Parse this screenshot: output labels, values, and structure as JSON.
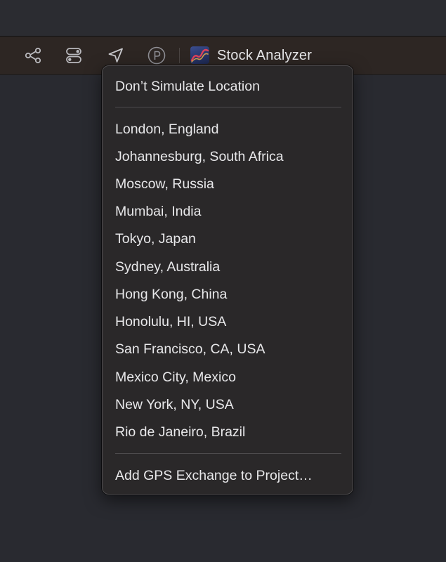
{
  "toolbar": {
    "icons": [
      "source-control-icon",
      "toggle-icon",
      "location-arrow-icon",
      "package-icon"
    ],
    "app_title": "Stock Analyzer"
  },
  "menu": {
    "top_item": "Don’t Simulate Location",
    "locations": [
      "London, England",
      "Johannesburg, South Africa",
      "Moscow, Russia",
      "Mumbai, India",
      "Tokyo, Japan",
      "Sydney, Australia",
      "Hong Kong, China",
      "Honolulu, HI, USA",
      "San Francisco, CA, USA",
      "Mexico City, Mexico",
      "New York, NY, USA",
      "Rio de Janeiro, Brazil"
    ],
    "bottom_item": "Add GPS Exchange to Project…"
  },
  "colors": {
    "background": "#292a30",
    "toolbar": "#2d2623",
    "menu_background": "#2a2829",
    "menu_text": "#e8e8ea",
    "icon": "#b9b9bd"
  }
}
